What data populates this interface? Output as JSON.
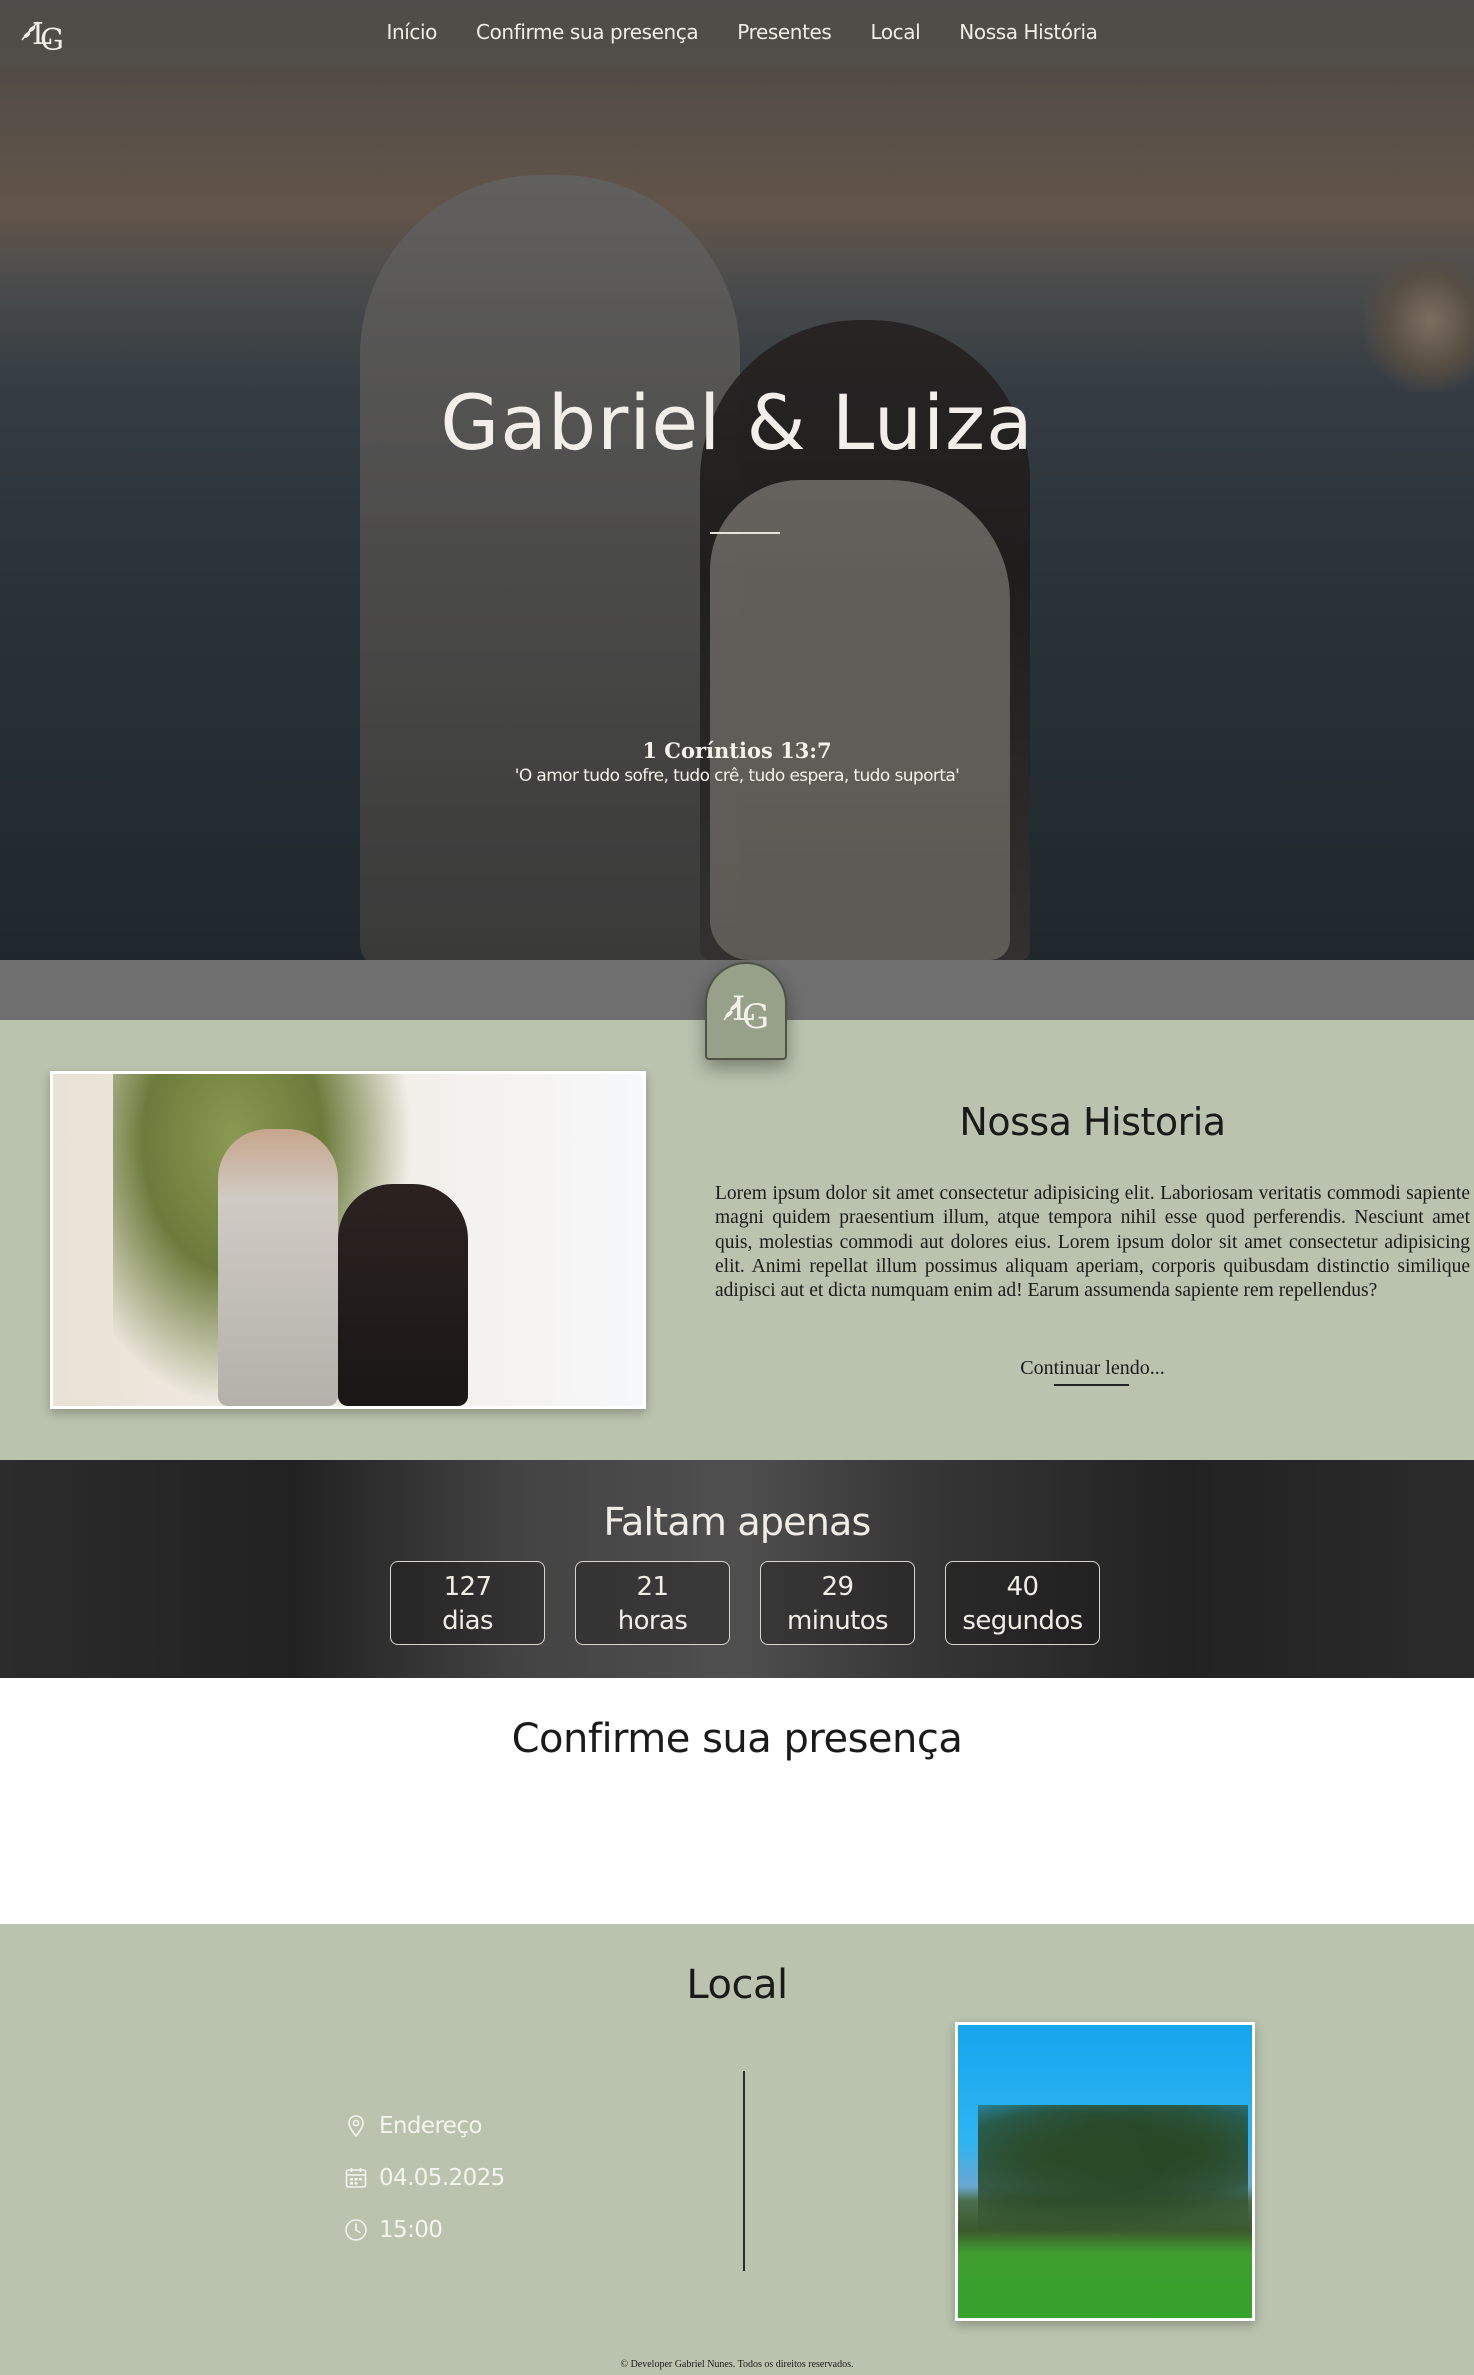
{
  "nav": {
    "items": [
      {
        "label": "Início"
      },
      {
        "label": "Confirme sua presença"
      },
      {
        "label": "Presentes"
      },
      {
        "label": "Local"
      },
      {
        "label": "Nossa História"
      }
    ]
  },
  "hero": {
    "title": "Gabriel & Luiza",
    "verse_ref": "1 Coríntios 13:7",
    "verse_text": "'O amor tudo sofre, tudo crê, tudo espera, tudo suporta'"
  },
  "story": {
    "title": "Nossa Historia",
    "body": "Lorem ipsum dolor sit amet consectetur adipisicing elit. Laboriosam veritatis commodi sapiente magni quidem praesentium illum, atque tempora nihil esse quod perferendis. Nesciunt amet quis, molestias commodi aut dolores eius. Lorem ipsum dolor sit amet consectetur adipisicing elit. Animi repellat illum possimus aliquam aperiam, corporis quibusdam distinctio similique adipisci aut et dicta numquam enim ad! Earum assumenda sapiente rem repellendus?",
    "read_more": "Continuar lendo..."
  },
  "countdown": {
    "title": "Faltam apenas",
    "units": [
      {
        "value": "127",
        "label": "dias"
      },
      {
        "value": "21",
        "label": "horas"
      },
      {
        "value": "29",
        "label": "minutos"
      },
      {
        "value": "40",
        "label": "segundos"
      }
    ]
  },
  "rsvp": {
    "title": "Confirme sua presença"
  },
  "local": {
    "title": "Local",
    "address_label": "Endereço",
    "date": "04.05.2025",
    "time": "15:00"
  },
  "footer": {
    "text": "© Developer Gabriel Nunes. Todos os direitos reservados."
  },
  "colors": {
    "sage": "#b9c3ad",
    "badge": "#97a088",
    "nav_bg": "#504e4a"
  }
}
